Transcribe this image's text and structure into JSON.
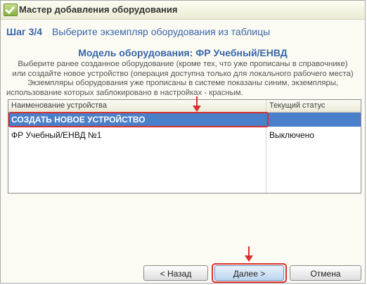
{
  "window": {
    "title": "Мастер добавления оборудования"
  },
  "step": {
    "number": "Шаг 3/4",
    "text": "Выберите экземпляр оборудования из таблицы"
  },
  "model_title": "Модель оборудования: ФР Учебный/ЕНВД",
  "description": {
    "line1": "Выберите ранее созданное оборудование (кроме тех, что уже прописаны в справочнике)",
    "line2": "или создайте новое устройство (операция доступна только для локального рабочего места)",
    "line3": "Экземпляры оборудования уже прописаны в системе показаны синим, экземпляры,",
    "line4": "использование которых заблокировано в настройках - красным."
  },
  "table": {
    "columns": [
      "Наименование устройства",
      "Текущий статус"
    ],
    "rows": [
      {
        "name": "СОЗДАТЬ НОВОЕ УСТРОЙСТВО",
        "status": ""
      },
      {
        "name": "ФР Учебный/ЕНВД №1",
        "status": "Выключено"
      }
    ]
  },
  "buttons": {
    "back": "< Назад",
    "next": "Далее >",
    "cancel": "Отмена"
  },
  "colors": {
    "accent": "#3a66a8",
    "selection": "#4a7fc9",
    "highlight": "#d9302c"
  }
}
